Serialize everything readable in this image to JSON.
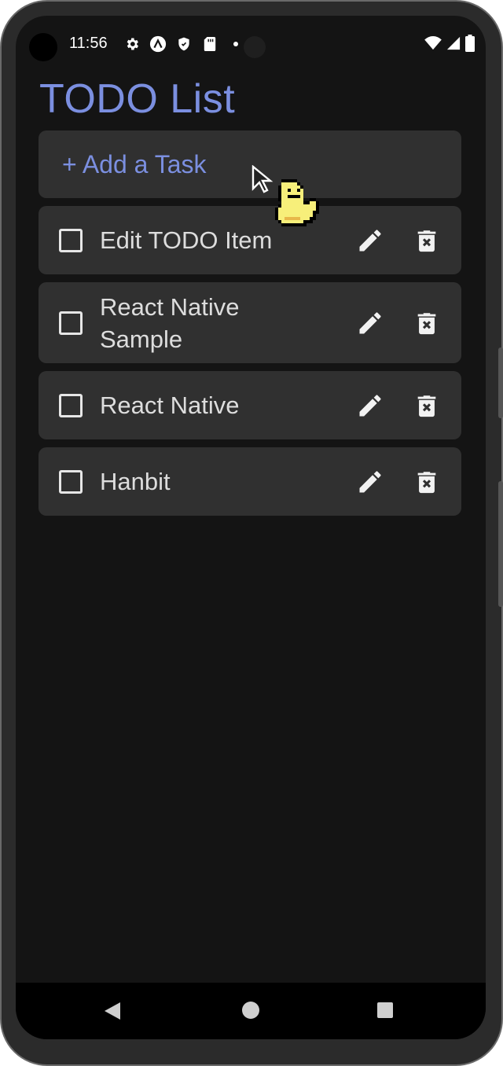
{
  "status_bar": {
    "time": "11:56",
    "icons": [
      "gear-icon",
      "expo-icon",
      "shield-icon",
      "sd-card-icon",
      "dot-icon"
    ],
    "right_icons": [
      "wifi-icon",
      "signal-icon",
      "battery-icon"
    ]
  },
  "app": {
    "title": "TODO List",
    "add_task_label": "+ Add a Task",
    "accent_color": "#7b8fe0",
    "items": [
      {
        "text": "Edit TODO Item",
        "checked": false
      },
      {
        "text": "React Native Sample",
        "checked": false
      },
      {
        "text": "React Native",
        "checked": false
      },
      {
        "text": "Hanbit",
        "checked": false
      }
    ]
  },
  "nav_bar": {
    "buttons": [
      "back-icon",
      "home-icon",
      "recents-icon"
    ]
  }
}
